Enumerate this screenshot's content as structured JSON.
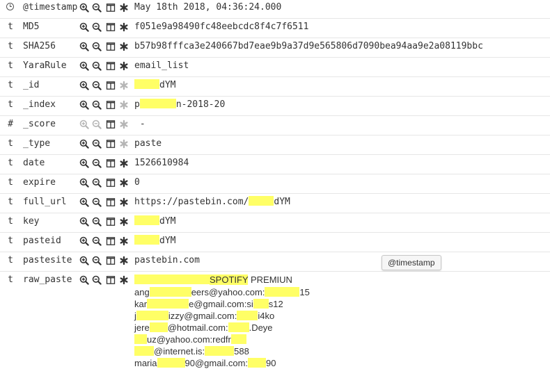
{
  "fields": [
    {
      "type": "clock",
      "name": "@timestamp",
      "value": "May 18th 2018, 04:36:24.000",
      "actions_enabled": true,
      "exists_enabled": true
    },
    {
      "type": "t",
      "name": "MD5",
      "value": "f051e9a98490fc48eebcdc8f4c7f6511",
      "actions_enabled": true,
      "exists_enabled": true
    },
    {
      "type": "t",
      "name": "SHA256",
      "value": "b57b98fffca3e240667bd7eae9b9a37d9e565806d7090bea94aa9e2a08119bbc",
      "actions_enabled": true,
      "exists_enabled": true
    },
    {
      "type": "t",
      "name": "YaraRule",
      "value": "email_list",
      "actions_enabled": true,
      "exists_enabled": true
    },
    {
      "type": "t",
      "name": "_id",
      "value_suffix": "dYM",
      "actions_enabled": true,
      "exists_enabled": false
    },
    {
      "type": "t",
      "name": "_index",
      "value_prefix": "p",
      "value_suffix": "n-2018-20",
      "actions_enabled": true,
      "exists_enabled": false
    },
    {
      "type": "#",
      "name": "_score",
      "value": " -",
      "actions_enabled": false,
      "exists_enabled": false
    },
    {
      "type": "t",
      "name": "_type",
      "value": "paste",
      "actions_enabled": true,
      "exists_enabled": false
    },
    {
      "type": "t",
      "name": "date",
      "value": "1526610984",
      "actions_enabled": true,
      "exists_enabled": true
    },
    {
      "type": "t",
      "name": "expire",
      "value": "0",
      "actions_enabled": true,
      "exists_enabled": true
    },
    {
      "type": "t",
      "name": "full_url",
      "value_prefix": "https://pastebin.com/",
      "value_suffix": "dYM",
      "actions_enabled": true,
      "exists_enabled": true
    },
    {
      "type": "t",
      "name": "key",
      "value_suffix": "dYM",
      "actions_enabled": true,
      "exists_enabled": true
    },
    {
      "type": "t",
      "name": "pasteid",
      "value_suffix": "dYM",
      "actions_enabled": true,
      "exists_enabled": true
    },
    {
      "type": "t",
      "name": "pastesite",
      "value": "pastebin.com",
      "actions_enabled": true,
      "exists_enabled": true
    },
    {
      "type": "t",
      "name": "raw_paste",
      "actions_enabled": true,
      "exists_enabled": true
    }
  ],
  "raw_paste": {
    "highlight_word": "SPOTIFY",
    "header_suffix": " PREMIUN",
    "lines": [
      {
        "a": "ang",
        "b": "eers@yahoo.com:",
        "c": "15"
      },
      {
        "a": "kar",
        "b": "e@gmail.com:si",
        "c": "s12"
      },
      {
        "a": "j",
        "b": "izzy@gmail.com:",
        "c": "i4ko"
      },
      {
        "a": "jere",
        "b": "@hotmail.com:",
        "c": ".Deye"
      },
      {
        "a": "",
        "b": "uz@yahoo.com:redfr",
        "c": ""
      },
      {
        "a": "",
        "b": "@internet.is:",
        "c": "588"
      },
      {
        "a": "maria",
        "b": "90@gmail.com:",
        "c": "90"
      }
    ]
  },
  "tooltip": {
    "text": "@timestamp"
  },
  "colors": {
    "highlight": "#ffff66",
    "icon": "#333333",
    "icon_disabled": "#b5b5b5",
    "row_border": "#e6e6e6"
  },
  "icons": {
    "filter_for": "zoom-in-icon",
    "filter_out": "zoom-out-icon",
    "toggle_column": "column-icon",
    "filter_exists": "asterisk-icon"
  }
}
